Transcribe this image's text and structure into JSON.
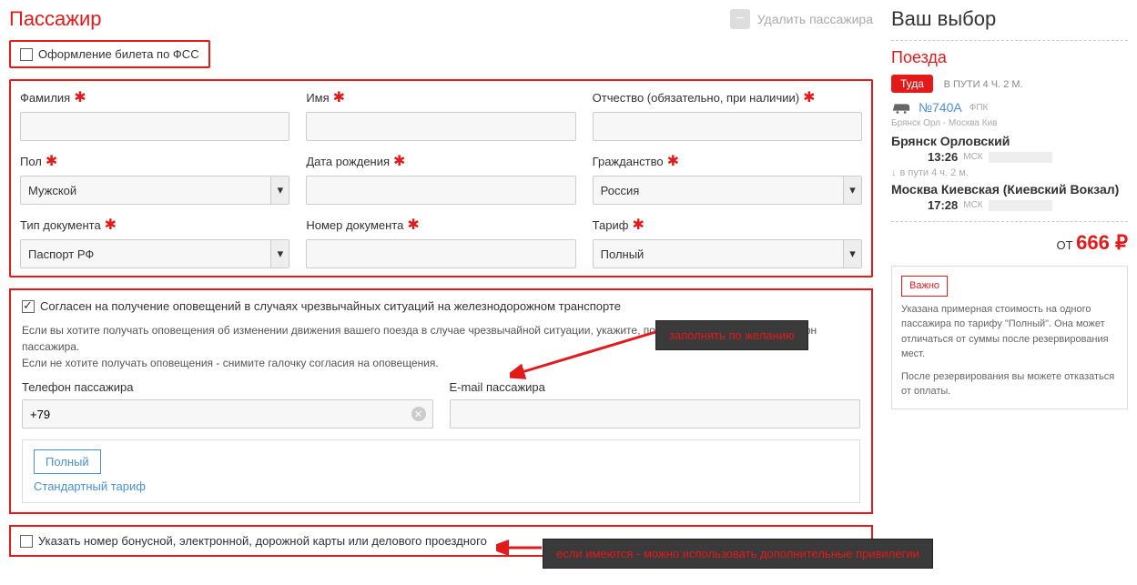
{
  "header": {
    "title": "Пассажир",
    "delete_label": "Удалить пассажира"
  },
  "fss": {
    "label": "Оформление билета по ФСС"
  },
  "form": {
    "surname": {
      "label": "Фамилия"
    },
    "name": {
      "label": "Имя"
    },
    "patronymic": {
      "label": "Отчество (обязательно, при наличии)"
    },
    "gender": {
      "label": "Пол",
      "value": "Мужской"
    },
    "birthdate": {
      "label": "Дата рождения"
    },
    "citizenship": {
      "label": "Гражданство",
      "value": "Россия"
    },
    "doc_type": {
      "label": "Тип документа",
      "value": "Паспорт РФ"
    },
    "doc_number": {
      "label": "Номер документа"
    },
    "tariff": {
      "label": "Тариф",
      "value": "Полный"
    }
  },
  "consent": {
    "checkbox_label": "Согласен на получение оповещений в случаях чрезвычайных ситуаций на железнодорожном транспорте",
    "info1": "Если вы хотите получать оповещения об изменении движения вашего поезда в случае чрезвычайной ситуации, укажите, пожалуйста, e-mail и/или телефон пассажира.",
    "info2": "Если не хотите получать оповещения - снимите галочку согласия на оповещения.",
    "phone_label": "Телефон пассажира",
    "phone_value": "+79",
    "email_label": "E-mail пассажира"
  },
  "tariff_block": {
    "button": "Полный",
    "link": "Стандартный тариф"
  },
  "bonus": {
    "label": "Указать номер бонусной, электронной, дорожной карты или делового проездного"
  },
  "callouts": {
    "optional": "заполнять по желанию",
    "bonus_hint": "если имеются - можно использовать дополнительные привилегии"
  },
  "sidebar": {
    "title": "Ваш выбор",
    "subtitle": "Поезда",
    "direction": "Туда",
    "travel_time": "В ПУТИ 4 Ч. 2 М.",
    "train_number": "№740А",
    "operator": "ФПК",
    "route": "Брянск Орл - Москва Кив",
    "station_from": "Брянск Орловский",
    "time_from": "13:26",
    "tz": "МСК",
    "travel_inline": "в пути  4 ч. 2 м.",
    "station_to": "Москва Киевская (Киевский Вокзал)",
    "time_to": "17:28",
    "price_from": "ОТ",
    "price": "666 ₽",
    "important": "Важно",
    "important_text1": "Указана примерная стоимость на одного пассажира по тарифу \"Полный\". Она может отличаться от суммы после резервирования мест.",
    "important_text2": "После резервирования вы можете отказаться от оплаты."
  }
}
